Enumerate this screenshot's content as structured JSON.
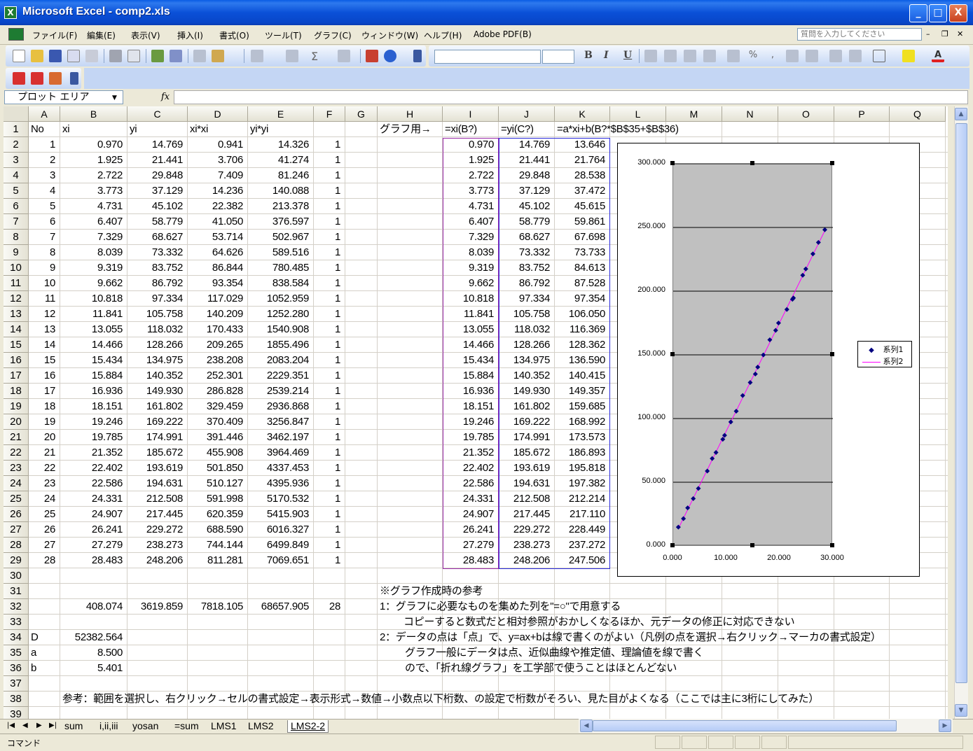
{
  "window": {
    "title": "Microsoft Excel - comp2.xls",
    "min": "_",
    "max": "□",
    "close": "X"
  },
  "menu": {
    "items": [
      "ファイル(F)",
      "編集(E)",
      "表示(V)",
      "挿入(I)",
      "書式(O)",
      "ツール(T)",
      "グラフ(C)",
      "ウィンドウ(W)",
      "ヘルプ(H)",
      "Adobe PDF(B)"
    ],
    "help_placeholder": "質問を入力してください"
  },
  "formula_bar": {
    "name_box": "プロット エリア",
    "fx": "fx",
    "content": ""
  },
  "columns": [
    "A",
    "B",
    "C",
    "D",
    "E",
    "F",
    "G",
    "H",
    "I",
    "J",
    "K",
    "L",
    "M",
    "N",
    "O",
    "P",
    "Q"
  ],
  "rows": [
    "1",
    "2",
    "3",
    "4",
    "5",
    "6",
    "7",
    "8",
    "9",
    "10",
    "11",
    "12",
    "13",
    "14",
    "15",
    "16",
    "17",
    "18",
    "19",
    "20",
    "21",
    "22",
    "23",
    "24",
    "25",
    "26",
    "27",
    "28",
    "29",
    "30",
    "31",
    "32",
    "33",
    "34",
    "35",
    "36",
    "37",
    "38",
    "39"
  ],
  "header_row": {
    "A": "No",
    "B": "xi",
    "C": "yi",
    "D": "xi*xi",
    "E": "yi*yi",
    "H": "グラフ用→",
    "I": "=xi(B?)",
    "J": "=yi(C?)",
    "K": "=a*xi+b(B?*$B$35+$B$36)"
  },
  "table": [
    [
      "1",
      "0.970",
      "14.769",
      "0.941",
      "14.326",
      "1",
      "0.970",
      "14.769",
      "13.646"
    ],
    [
      "2",
      "1.925",
      "21.441",
      "3.706",
      "41.274",
      "1",
      "1.925",
      "21.441",
      "21.764"
    ],
    [
      "3",
      "2.722",
      "29.848",
      "7.409",
      "81.246",
      "1",
      "2.722",
      "29.848",
      "28.538"
    ],
    [
      "4",
      "3.773",
      "37.129",
      "14.236",
      "140.088",
      "1",
      "3.773",
      "37.129",
      "37.472"
    ],
    [
      "5",
      "4.731",
      "45.102",
      "22.382",
      "213.378",
      "1",
      "4.731",
      "45.102",
      "45.615"
    ],
    [
      "6",
      "6.407",
      "58.779",
      "41.050",
      "376.597",
      "1",
      "6.407",
      "58.779",
      "59.861"
    ],
    [
      "7",
      "7.329",
      "68.627",
      "53.714",
      "502.967",
      "1",
      "7.329",
      "68.627",
      "67.698"
    ],
    [
      "8",
      "8.039",
      "73.332",
      "64.626",
      "589.516",
      "1",
      "8.039",
      "73.332",
      "73.733"
    ],
    [
      "9",
      "9.319",
      "83.752",
      "86.844",
      "780.485",
      "1",
      "9.319",
      "83.752",
      "84.613"
    ],
    [
      "10",
      "9.662",
      "86.792",
      "93.354",
      "838.584",
      "1",
      "9.662",
      "86.792",
      "87.528"
    ],
    [
      "11",
      "10.818",
      "97.334",
      "117.029",
      "1052.959",
      "1",
      "10.818",
      "97.334",
      "97.354"
    ],
    [
      "12",
      "11.841",
      "105.758",
      "140.209",
      "1252.280",
      "1",
      "11.841",
      "105.758",
      "106.050"
    ],
    [
      "13",
      "13.055",
      "118.032",
      "170.433",
      "1540.908",
      "1",
      "13.055",
      "118.032",
      "116.369"
    ],
    [
      "14",
      "14.466",
      "128.266",
      "209.265",
      "1855.496",
      "1",
      "14.466",
      "128.266",
      "128.362"
    ],
    [
      "15",
      "15.434",
      "134.975",
      "238.208",
      "2083.204",
      "1",
      "15.434",
      "134.975",
      "136.590"
    ],
    [
      "16",
      "15.884",
      "140.352",
      "252.301",
      "2229.351",
      "1",
      "15.884",
      "140.352",
      "140.415"
    ],
    [
      "17",
      "16.936",
      "149.930",
      "286.828",
      "2539.214",
      "1",
      "16.936",
      "149.930",
      "149.357"
    ],
    [
      "18",
      "18.151",
      "161.802",
      "329.459",
      "2936.868",
      "1",
      "18.151",
      "161.802",
      "159.685"
    ],
    [
      "19",
      "19.246",
      "169.222",
      "370.409",
      "3256.847",
      "1",
      "19.246",
      "169.222",
      "168.992"
    ],
    [
      "20",
      "19.785",
      "174.991",
      "391.446",
      "3462.197",
      "1",
      "19.785",
      "174.991",
      "173.573"
    ],
    [
      "21",
      "21.352",
      "185.672",
      "455.908",
      "3964.469",
      "1",
      "21.352",
      "185.672",
      "186.893"
    ],
    [
      "22",
      "22.402",
      "193.619",
      "501.850",
      "4337.453",
      "1",
      "22.402",
      "193.619",
      "195.818"
    ],
    [
      "23",
      "22.586",
      "194.631",
      "510.127",
      "4395.936",
      "1",
      "22.586",
      "194.631",
      "197.382"
    ],
    [
      "24",
      "24.331",
      "212.508",
      "591.998",
      "5170.532",
      "1",
      "24.331",
      "212.508",
      "212.214"
    ],
    [
      "25",
      "24.907",
      "217.445",
      "620.359",
      "5415.903",
      "1",
      "24.907",
      "217.445",
      "217.110"
    ],
    [
      "26",
      "26.241",
      "229.272",
      "688.590",
      "6016.327",
      "1",
      "26.241",
      "229.272",
      "228.449"
    ],
    [
      "27",
      "27.279",
      "238.273",
      "744.144",
      "6499.849",
      "1",
      "27.279",
      "238.273",
      "237.272"
    ],
    [
      "28",
      "28.483",
      "248.206",
      "811.281",
      "7069.651",
      "1",
      "28.483",
      "248.206",
      "247.506"
    ]
  ],
  "sums": {
    "B": "408.074",
    "C": "3619.859",
    "D": "7818.105",
    "E": "68657.905",
    "F": "28"
  },
  "params": [
    {
      "label": "D",
      "value": "52382.564"
    },
    {
      "label": "a",
      "value": "8.500"
    },
    {
      "label": "b",
      "value": "5.401"
    }
  ],
  "notes": {
    "r31": "※グラフ作成時の参考",
    "r32": "1：グラフに必要なものを集めた列を\"=○\"で用意する",
    "r33": "コピーすると数式だと相対参照がおかしくなるほか、元データの修正に対応できない",
    "r34": "2：データの点は「点」で、y=ax+bは線で書くのがよい（凡例の点を選択→右クリック→マーカの書式設定）",
    "r35": "グラフ一般にデータは点、近似曲線や推定値、理論値を線で書く",
    "r36": "ので、「折れ線グラフ」を工学部で使うことはほとんどない",
    "r38": "参考：範囲を選択し、右クリック→セルの書式設定→表示形式→数値→小数点以下桁数、の設定で桁数がそろい、見た目がよくなる（ここでは主に3桁にしてみた）"
  },
  "chart_data": {
    "type": "scatter",
    "xlim": [
      0,
      30
    ],
    "ylim": [
      0,
      300
    ],
    "x_ticks": [
      "0.000",
      "10.000",
      "20.000",
      "30.000"
    ],
    "y_ticks": [
      "0.000",
      "50.000",
      "100.000",
      "150.000",
      "200.000",
      "250.000",
      "300.000"
    ],
    "grid": true,
    "legend": "right",
    "series": [
      {
        "name": "系列1",
        "style": "markers",
        "color": "#000080",
        "x": [
          0.97,
          1.925,
          2.722,
          3.773,
          4.731,
          6.407,
          7.329,
          8.039,
          9.319,
          9.662,
          10.818,
          11.841,
          13.055,
          14.466,
          15.434,
          15.884,
          16.936,
          18.151,
          19.246,
          19.785,
          21.352,
          22.402,
          22.586,
          24.331,
          24.907,
          26.241,
          27.279,
          28.483
        ],
        "y": [
          14.769,
          21.441,
          29.848,
          37.129,
          45.102,
          58.779,
          68.627,
          73.332,
          83.752,
          86.792,
          97.334,
          105.758,
          118.032,
          128.266,
          134.975,
          140.352,
          149.93,
          161.802,
          169.222,
          174.991,
          185.672,
          193.619,
          194.631,
          212.508,
          217.445,
          229.272,
          238.273,
          248.206
        ]
      },
      {
        "name": "系列2",
        "style": "line",
        "color": "#ff00ff",
        "x": [
          0.97,
          1.925,
          2.722,
          3.773,
          4.731,
          6.407,
          7.329,
          8.039,
          9.319,
          9.662,
          10.818,
          11.841,
          13.055,
          14.466,
          15.434,
          15.884,
          16.936,
          18.151,
          19.246,
          19.785,
          21.352,
          22.402,
          22.586,
          24.331,
          24.907,
          26.241,
          27.279,
          28.483
        ],
        "y": [
          13.646,
          21.764,
          28.538,
          37.472,
          45.615,
          59.861,
          67.698,
          73.733,
          84.613,
          87.528,
          97.354,
          106.05,
          116.369,
          128.362,
          136.59,
          140.415,
          149.357,
          159.685,
          168.992,
          173.573,
          186.893,
          195.818,
          197.382,
          212.214,
          217.11,
          228.449,
          237.272,
          247.506
        ]
      }
    ]
  },
  "sheet_tabs": [
    "sum",
    "i,ii,iii",
    "yosan",
    "=sum",
    "LMS1",
    "LMS2",
    "LMS2-2"
  ],
  "active_tab": "LMS2-2",
  "status": "コマンド"
}
